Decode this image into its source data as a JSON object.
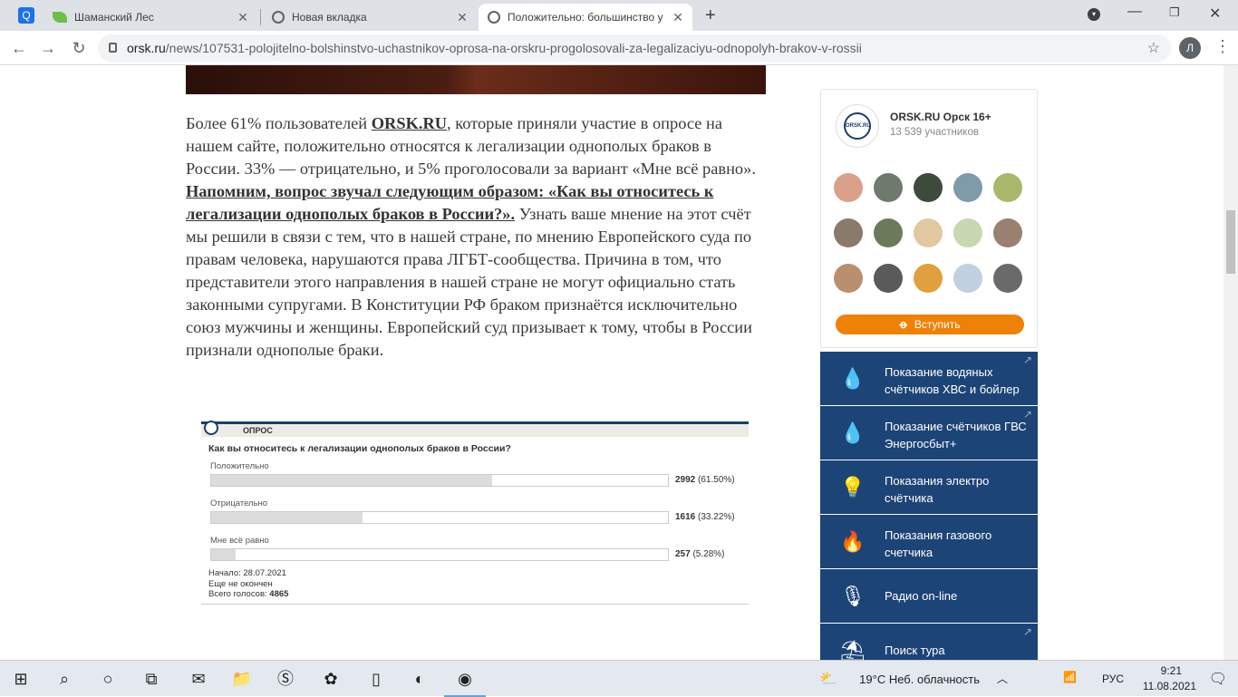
{
  "tabs": [
    {
      "title": "Шаманский Лес",
      "active": false
    },
    {
      "title": "Новая вкладка",
      "active": false
    },
    {
      "title": "Положительно: большинство у",
      "active": true
    }
  ],
  "omnibox": {
    "host": "orsk.ru",
    "path": "/news/107531-polojitelno-bolshinstvo-uchastnikov-oprosa-na-orskru-progolosovali-za-legalizaciyu-odnopolyh-brakov-v-rossii"
  },
  "profile": {
    "initial": "Л"
  },
  "article": {
    "p1a": "Более 61% пользователей ",
    "link1": "ORSK.RU",
    "p1b": ", которые приняли участие в опросе на нашем сайте, положительно относятся к легализации однополых браков в России. 33% — отрицательно, и 5% проголосовали за вариант «Мне всё равно». ",
    "link2": "Напомним, вопрос звучал следующим образом: «Как вы относитесь к легализации однополых браков в России?».",
    "p1c": " Узнать ваше мнение на этот счёт мы решили в связи с тем, что в нашей стране, по мнению Европейского суда по правам человека, нарушаются права ЛГБТ-сообщества. Причина в том, что представители этого направления в нашей стране не могут официально стать законными супругами. В Конституции РФ браком признаётся исключительно союз мужчины и женщины. Европейский суд призывает к тому, чтобы в России признали однополые браки."
  },
  "poll": {
    "header": "ОПРОС",
    "question": "Как вы относитесь к легализации однополых браков в России?",
    "options": [
      {
        "label": "Положительно",
        "votes": "2992",
        "percent": "(61.50%)",
        "fill": 0.615
      },
      {
        "label": "Отрицательно",
        "votes": "1616",
        "percent": "(33.22%)",
        "fill": 0.3322
      },
      {
        "label": "Мне всё равно",
        "votes": "257",
        "percent": "(5.28%)",
        "fill": 0.0528
      }
    ],
    "start": "Начало: 28.07.2021",
    "status": "Еще не окончен",
    "total_label": "Всего голосов: ",
    "total": "4865"
  },
  "ok_widget": {
    "logo_text": "ORSK.RU",
    "name": "ORSK.RU Орск 16+",
    "members": "13 539 участников",
    "join": "Вступить",
    "avatar_colors": [
      "#d9a08a",
      "#6f7a6e",
      "#3e4a3c",
      "#7f9aa8",
      "#a8b86a",
      "#8a7a6a",
      "#6a7a5a",
      "#e0c9a0",
      "#c8d8b0",
      "#9a8070",
      "#b89070",
      "#5a5a5a",
      "#e0a040",
      "#c0d0e0",
      "#6a6a6a"
    ]
  },
  "services": [
    {
      "text": "Показание водяных счётчиков ХВС и бойлер",
      "icon": "water-drop-icon",
      "glyph": "💧",
      "arrow": true
    },
    {
      "text": "Показание счётчиков ГВС Энергосбыт+",
      "icon": "water-drop-icon",
      "glyph": "💧",
      "arrow": true
    },
    {
      "text": "Показания электро счётчика",
      "icon": "light-bulb-icon",
      "glyph": "💡",
      "arrow": false
    },
    {
      "text": "Показания газового счетчика",
      "icon": "flame-icon",
      "glyph": "🔥",
      "arrow": false
    },
    {
      "text": "Радио on-line",
      "icon": "microphone-icon",
      "glyph": "🎙",
      "arrow": false
    },
    {
      "text": "Поиск тура",
      "icon": "beach-umbrella-icon",
      "glyph": "⛱",
      "arrow": true
    }
  ],
  "taskbar": {
    "weather": "19°C  Неб. облачность",
    "lang": "РУС",
    "time": "9:21",
    "date": "11.08.2021"
  }
}
